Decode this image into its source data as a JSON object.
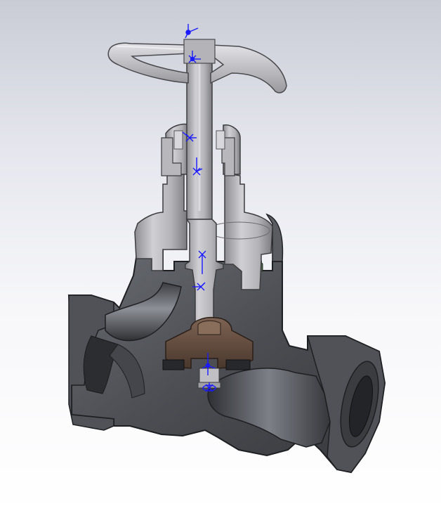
{
  "view": {
    "background_top": "#c9ccd6",
    "background_bottom": "#ffffff"
  },
  "model": {
    "name": "globe-valve-section-view",
    "components": [
      "handwheel",
      "valve-stem",
      "gland-nut",
      "packing-gland",
      "bonnet",
      "gasket",
      "valve-body",
      "valve-disc",
      "disc-washer",
      "inlet-port",
      "outlet-port"
    ]
  },
  "colors": {
    "body_cut": "#55575d",
    "body_shade": "#3d3f44",
    "body_highlight": "#8a8d94",
    "steel_light": "#c4c4c8",
    "steel_mid": "#a8a8ac",
    "steel_dark": "#7c7c80",
    "disc": "#6d5444",
    "disc_dark": "#4a382d",
    "gasket": "#4f6b4e",
    "triad": "#1a1aff"
  },
  "icons": {
    "mate_marker": "coordinate-triad-icon",
    "mate_count": 8
  }
}
